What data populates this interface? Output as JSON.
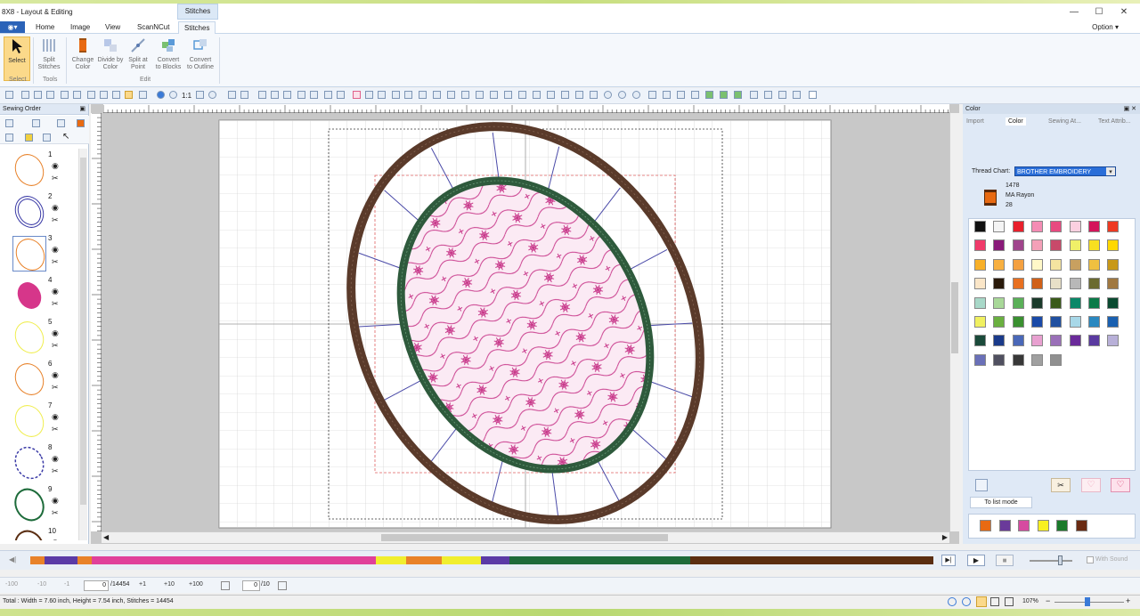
{
  "window": {
    "title": "8X8 - Layout & Editing",
    "context_tab": "Stitches",
    "minimize_glyph": "—",
    "maximize_glyph": "☐",
    "close_glyph": "✕"
  },
  "ribbon_tabs": [
    "Home",
    "Image",
    "View",
    "ScanNCut",
    "Stitches"
  ],
  "active_tab": "Stitches",
  "option_label": "Option",
  "ribbon": {
    "select_label": "Select",
    "split_stitches": "Split Stitches",
    "change_color": "Change Color",
    "divide_by_color": "Divide by Color",
    "split_at_point": "Split at Point",
    "convert_to_blocks": "Convert to Blocks",
    "convert_to_outline": "Convert to Outline",
    "groups": {
      "select": "Select",
      "tools": "Tools",
      "edit": "Edit"
    }
  },
  "sewing_order": {
    "title": "Sewing Order",
    "items": [
      {
        "num": "1",
        "color": "#e8822a",
        "kind": "ellipse-outline"
      },
      {
        "num": "2",
        "color": "#3a3aa6",
        "kind": "ellipse-double"
      },
      {
        "num": "3",
        "color": "#e8822a",
        "kind": "ellipse-outline"
      },
      {
        "num": "4",
        "color": "#d6368a",
        "kind": "ellipse-fill"
      },
      {
        "num": "5",
        "color": "#f0ee50",
        "kind": "ellipse-outline"
      },
      {
        "num": "6",
        "color": "#e8822a",
        "kind": "ellipse-outline"
      },
      {
        "num": "7",
        "color": "#f0ee50",
        "kind": "ellipse-outline"
      },
      {
        "num": "8",
        "color": "#3a3aa6",
        "kind": "scalloped"
      },
      {
        "num": "9",
        "color": "#1d6b3a",
        "kind": "ellipse-outline"
      },
      {
        "num": "10",
        "color": "#5a2e12",
        "kind": "ellipse-outline"
      }
    ]
  },
  "color_panel": {
    "title": "Color",
    "tabs": [
      "Import",
      "Color",
      "Sewing At...",
      "Text Attrib..."
    ],
    "thread_chart_label": "Thread Chart:",
    "thread_chart_value": "BROTHER EMBROIDERY",
    "current_thread": {
      "code": "1478",
      "name": "MA Rayon",
      "number": "28",
      "color": "#e86a12"
    },
    "palette": [
      "#111111",
      "#f4f4f4",
      "#e8202c",
      "#f48cb4",
      "#e84a80",
      "#fbd0e0",
      "#d4145a",
      "#ee3a22",
      "#f03a6a",
      "#8a1a7a",
      "#a0448c",
      "#f4a0b8",
      "#c84a6a",
      "#f0f068",
      "#f8e020",
      "#ffd800",
      "#f8b028",
      "#f8b040",
      "#f4a040",
      "#fff8c8",
      "#f4e4a0",
      "#c8a060",
      "#f0c040",
      "#c89818",
      "#fbe6c8",
      "#2a1a0a",
      "#e87020",
      "#d06018",
      "#e8e0c8",
      "#b8b8b8",
      "#6a6a30",
      "#a07840",
      "#a8d8c8",
      "#a8d898",
      "#5ab058",
      "#1a3a2a",
      "#3a5a1a",
      "#0a8868",
      "#0a7a48",
      "#0a4a30",
      "#f0f060",
      "#6ab040",
      "#3a9030",
      "#1a4aa8",
      "#2050a0",
      "#a8d8e8",
      "#2a88c0",
      "#1a60b0",
      "#1a4a3a",
      "#1a3a8a",
      "#4a68b8",
      "#e8a0d0",
      "#9a70b8",
      "#6a2a9a",
      "#5a3aa0",
      "#b8b0d8",
      "#6a70b8",
      "#505060",
      "#383838",
      "#a0a0a0",
      "#909090"
    ],
    "to_list_mode": "To list mode",
    "used_colors": [
      "#e86a12",
      "#6a3a9a",
      "#d64aa0",
      "#f8f020",
      "#1a7a2a",
      "#6a2a12"
    ]
  },
  "timeline": {
    "segments": [
      {
        "color": "#e8822a",
        "w": 1.6
      },
      {
        "color": "#5a3aa6",
        "w": 3.6
      },
      {
        "color": "#e8822a",
        "w": 1.6
      },
      {
        "color": "#e0409a",
        "w": 31.5
      },
      {
        "color": "#f0ee30",
        "w": 3.3
      },
      {
        "color": "#e8822a",
        "w": 4.0
      },
      {
        "color": "#f0ee30",
        "w": 4.3
      },
      {
        "color": "#5a3aa6",
        "w": 3.2
      },
      {
        "color": "#1d6b3a",
        "w": 20.0
      },
      {
        "color": "#5a2e12",
        "w": 26.9
      }
    ]
  },
  "navigation": {
    "b100": "-100",
    "b10": "-10",
    "b1": "-1",
    "stitch_pos": "0",
    "stitch_total": "/14454",
    "f1": "+1",
    "f10": "+10",
    "f100": "+100",
    "color_pos": "0",
    "color_total": "/10",
    "with_sound": "With Sound"
  },
  "status": {
    "text": "Total : Width = 7.60 inch, Height = 7.54 inch, Stitches = 14454",
    "zoom": "107%"
  }
}
